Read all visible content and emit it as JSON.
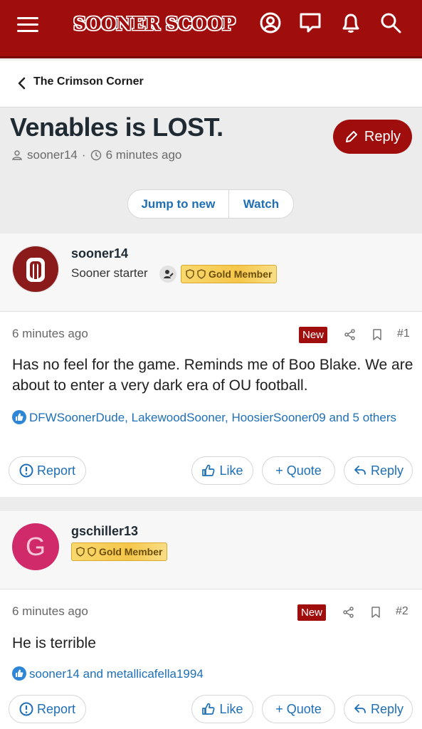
{
  "header": {
    "logo_text": "SOONER SCOOP",
    "brand_color": "#a00d0d"
  },
  "breadcrumb": {
    "label": "The Crimson Corner"
  },
  "thread": {
    "title": "Venables is LOST.",
    "reply_label": "Reply",
    "author": "sooner14",
    "separator": "·",
    "time": "6 minutes ago",
    "jump_label": "Jump to new",
    "watch_label": "Watch"
  },
  "posts": [
    {
      "username": "sooner14",
      "user_title": "Sooner starter",
      "badge": "Gold Member",
      "avatar_text": "OU",
      "time": "6 minutes ago",
      "new_label": "New",
      "number": "#1",
      "body": "Has no feel for the game. Reminds me of Boo Blake. We are about to enter a very dark era of OU football.",
      "reactions": "DFWSoonerDude, LakewoodSooner, HoosierSooner09 and 5 others",
      "report_label": "Report",
      "like_label": "Like",
      "quote_label": "Quote",
      "reply_label": "Reply"
    },
    {
      "username": "gschiller13",
      "badge": "Gold Member",
      "avatar_text": "G",
      "avatar_color": "#d12a6a",
      "time": "6 minutes ago",
      "new_label": "New",
      "number": "#2",
      "body": "He is terrible",
      "reactions": "sooner14 and metallicafella1994",
      "report_label": "Report",
      "like_label": "Like",
      "quote_label": "Quote",
      "reply_label": "Reply"
    }
  ]
}
